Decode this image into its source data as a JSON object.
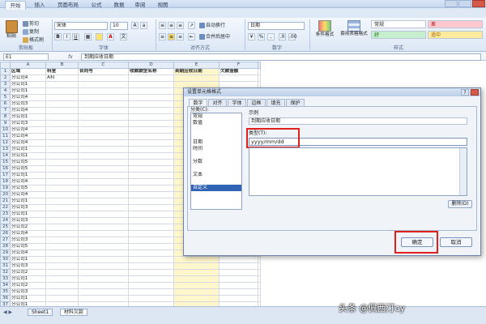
{
  "window": {
    "title": ""
  },
  "ribbon": {
    "tabs": [
      {
        "label": "开始",
        "active": true
      },
      {
        "label": "插入",
        "active": false
      },
      {
        "label": "页面布局",
        "active": false
      },
      {
        "label": "公式",
        "active": false
      },
      {
        "label": "数据",
        "active": false
      },
      {
        "label": "审阅",
        "active": false
      },
      {
        "label": "视图",
        "active": false
      }
    ],
    "clipboard": {
      "paste": "粘贴",
      "cut": "剪切",
      "copy": "复制",
      "format_painter": "格式刷",
      "group": "剪贴板"
    },
    "font": {
      "name": "宋体",
      "size": "10",
      "bold": "B",
      "italic": "I",
      "underline": "U",
      "group": "字体"
    },
    "alignment": {
      "wrap": "自动换行",
      "merge": "合并后居中",
      "group": "对齐方式"
    },
    "number": {
      "format": "日期",
      "percent": "%",
      "comma": ",",
      "group": "数字"
    },
    "styles": {
      "conditional": "条件格式",
      "table_format": "套用表格格式",
      "cells": [
        {
          "label": "常规",
          "bg": "#ffffff",
          "color": "#222222"
        },
        {
          "label": "差",
          "bg": "#ffc7ce",
          "color": "#9c0006"
        },
        {
          "label": "好",
          "bg": "#c6efce",
          "color": "#006100"
        },
        {
          "label": "适中",
          "bg": "#ffeb9c",
          "color": "#9c5700"
        }
      ],
      "group": "样式"
    }
  },
  "formula_bar": {
    "name_box": "E1",
    "fx": "fx",
    "content": "到期应收日期"
  },
  "columns": [
    "A",
    "B",
    "C",
    "D",
    "E",
    "F"
  ],
  "header_row": [
    "区域",
    "科室",
    "合同号",
    "收款款型名称",
    "到期应收日期",
    "欠款金额"
  ],
  "rows": [
    [
      "分公司4",
      "A科",
      "",
      "",
      "",
      ""
    ],
    [
      "分公司1",
      "",
      "",
      "",
      "",
      ""
    ],
    [
      "分公司1",
      "",
      "",
      "",
      "",
      ""
    ],
    [
      "分公司4",
      "",
      "",
      "",
      "",
      ""
    ],
    [
      "分公司3",
      "",
      "",
      "",
      "",
      ""
    ],
    [
      "分公司4",
      "",
      "",
      "",
      "",
      ""
    ],
    [
      "分公司1",
      "",
      "",
      "",
      "",
      ""
    ],
    [
      "分公司3",
      "",
      "",
      "",
      "",
      ""
    ],
    [
      "分公司4",
      "",
      "",
      "",
      "",
      ""
    ],
    [
      "分公司4",
      "",
      "",
      "",
      "",
      ""
    ],
    [
      "分公司4",
      "",
      "",
      "",
      "",
      ""
    ],
    [
      "分公司1",
      "",
      "",
      "",
      "",
      ""
    ],
    [
      "分公司1",
      "",
      "",
      "",
      "",
      ""
    ],
    [
      "分公司5",
      "",
      "",
      "",
      "",
      ""
    ],
    [
      "分公司5",
      "",
      "",
      "",
      "",
      ""
    ],
    [
      "分公司1",
      "",
      "",
      "",
      "",
      ""
    ],
    [
      "分公司4",
      "",
      "",
      "",
      "",
      ""
    ],
    [
      "分公司5",
      "",
      "",
      "",
      "",
      ""
    ],
    [
      "分公司4",
      "",
      "",
      "",
      "",
      ""
    ],
    [
      "分公司1",
      "",
      "",
      "",
      "",
      ""
    ],
    [
      "分公司3",
      "",
      "",
      "",
      "",
      ""
    ],
    [
      "分公司1",
      "",
      "",
      "",
      "",
      ""
    ],
    [
      "分公司3",
      "",
      "",
      "",
      "",
      ""
    ],
    [
      "分公司2",
      "",
      "",
      "",
      "",
      ""
    ],
    [
      "分公司4",
      "",
      "",
      "",
      "",
      ""
    ],
    [
      "分公司3",
      "",
      "",
      "",
      "",
      ""
    ],
    [
      "分公司5",
      "",
      "",
      "",
      "",
      ""
    ],
    [
      "分公司4",
      "",
      "",
      "",
      "",
      ""
    ],
    [
      "分公司1",
      "",
      "",
      "",
      "",
      ""
    ],
    [
      "分公司3",
      "",
      "",
      "",
      "",
      ""
    ],
    [
      "分公司2",
      "",
      "",
      "",
      "",
      ""
    ],
    [
      "分公司1",
      "",
      "",
      "",
      "",
      ""
    ],
    [
      "分公司2",
      "",
      "",
      "",
      "",
      ""
    ],
    [
      "分公司3",
      "",
      "",
      "",
      "",
      ""
    ],
    [
      "分公司1",
      "",
      "",
      "",
      "",
      ""
    ],
    [
      "分公司1",
      "",
      "",
      "",
      "",
      ""
    ],
    [
      "分公司3",
      "",
      "",
      "",
      "",
      ""
    ]
  ],
  "sheet_tabs": [
    {
      "label": "Sheet1",
      "active": false
    },
    {
      "label": "材料欠款",
      "active": true
    }
  ],
  "dialog": {
    "title": "设置单元格格式",
    "help": "?",
    "tabs": [
      {
        "label": "数字",
        "active": true
      },
      {
        "label": "对齐",
        "active": false
      },
      {
        "label": "字体",
        "active": false
      },
      {
        "label": "边框",
        "active": false
      },
      {
        "label": "填充",
        "active": false
      },
      {
        "label": "保护",
        "active": false
      }
    ],
    "category_label": "分类(C):",
    "categories": [
      {
        "label": "常规",
        "selected": false
      },
      {
        "label": "数值",
        "selected": false
      },
      {
        "label": "",
        "selected": false
      },
      {
        "label": "",
        "selected": false
      },
      {
        "label": "日期",
        "selected": false
      },
      {
        "label": "时间",
        "selected": false
      },
      {
        "label": "",
        "selected": false
      },
      {
        "label": "分数",
        "selected": false
      },
      {
        "label": "",
        "selected": false
      },
      {
        "label": "文本",
        "selected": false
      },
      {
        "label": "",
        "selected": false
      },
      {
        "label": "自定义",
        "selected": true
      }
    ],
    "sample_label": "示例",
    "sample_value": "到期应收日期",
    "type_label": "类型(T):",
    "type_value": "yyyy/mm/dd",
    "type_list": [
      "",
      "",
      "",
      "",
      "",
      "",
      "",
      ""
    ],
    "delete_label": "删除(D)",
    "hint": "",
    "ok_label": "确定",
    "cancel_label": "取消"
  },
  "watermark": "头条 @佩西汀cy",
  "colors": {
    "highlight_red": "#e0211b",
    "selection_blue": "#3163b5"
  }
}
